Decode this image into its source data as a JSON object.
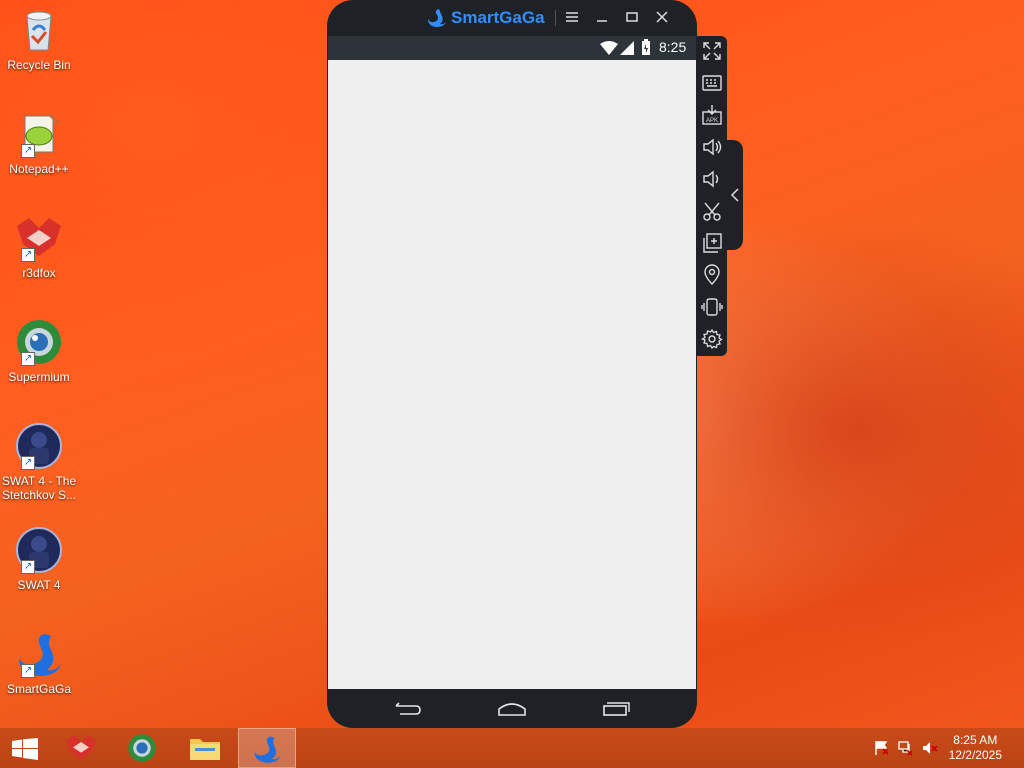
{
  "desktop": {
    "icons": [
      {
        "label": "Recycle Bin",
        "icon": "recycle-bin-icon"
      },
      {
        "label": "Notepad++",
        "icon": "notepad-plus-plus-icon"
      },
      {
        "label": "r3dfox",
        "icon": "r3dfox-icon"
      },
      {
        "label": "Supermium",
        "icon": "supermium-icon"
      },
      {
        "label": "SWAT 4 - The Stetchkov S...",
        "icon": "swat4-icon"
      },
      {
        "label": "SWAT 4",
        "icon": "swat4-icon"
      },
      {
        "label": "SmartGaGa",
        "icon": "smartgaga-icon"
      }
    ]
  },
  "emulator": {
    "title": "SmartGaGa",
    "status_time": "8:25",
    "colors": {
      "accent": "#2f8fff",
      "frame": "#1e2227",
      "screen": "#efefef"
    },
    "toolbar": [
      "fullscreen-icon",
      "keyboard-icon",
      "apk-install-icon",
      "volume-up-icon",
      "volume-down-icon",
      "screenshot-scissors-icon",
      "multi-instance-icon",
      "location-icon",
      "shake-icon",
      "settings-icon"
    ]
  },
  "taskbar": {
    "clock_time": "8:25 AM",
    "clock_date": "12/2/2025",
    "items": [
      "start-button",
      "r3dfox-taskbar",
      "supermium-taskbar",
      "file-explorer-taskbar",
      "smartgaga-taskbar"
    ]
  }
}
